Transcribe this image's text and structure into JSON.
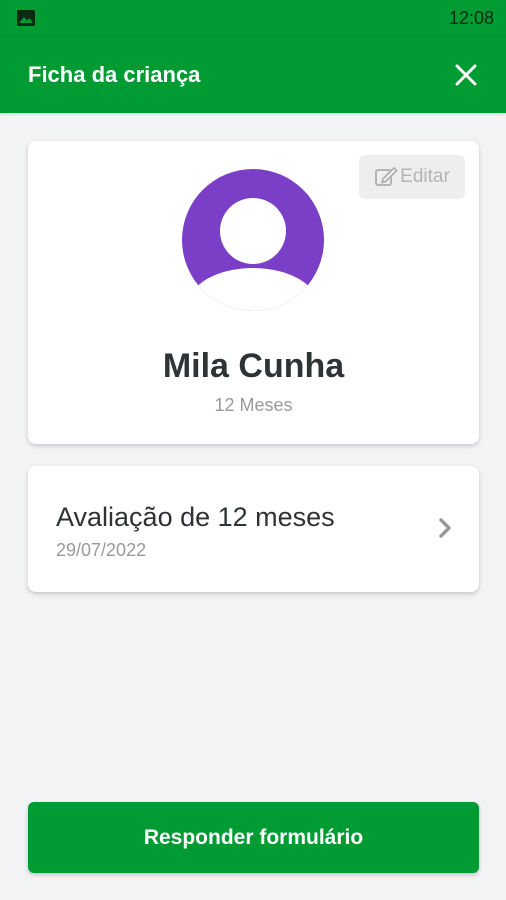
{
  "status_bar": {
    "time": "12:08",
    "left_icon": "image-icon"
  },
  "app_bar": {
    "title": "Ficha da criança",
    "close_icon": "close-icon"
  },
  "profile": {
    "edit_label": "Editar",
    "edit_icon": "edit-icon",
    "name": "Mila Cunha",
    "age": "12 Meses",
    "avatar_color": "#7a3fc6"
  },
  "evaluation": {
    "title": "Avaliação de 12 meses",
    "date": "29/07/2022",
    "chevron_icon": "chevron-right-icon"
  },
  "actions": {
    "submit_label": "Responder formulário"
  },
  "colors": {
    "primary": "#009b32",
    "background": "#f2f3f5"
  }
}
